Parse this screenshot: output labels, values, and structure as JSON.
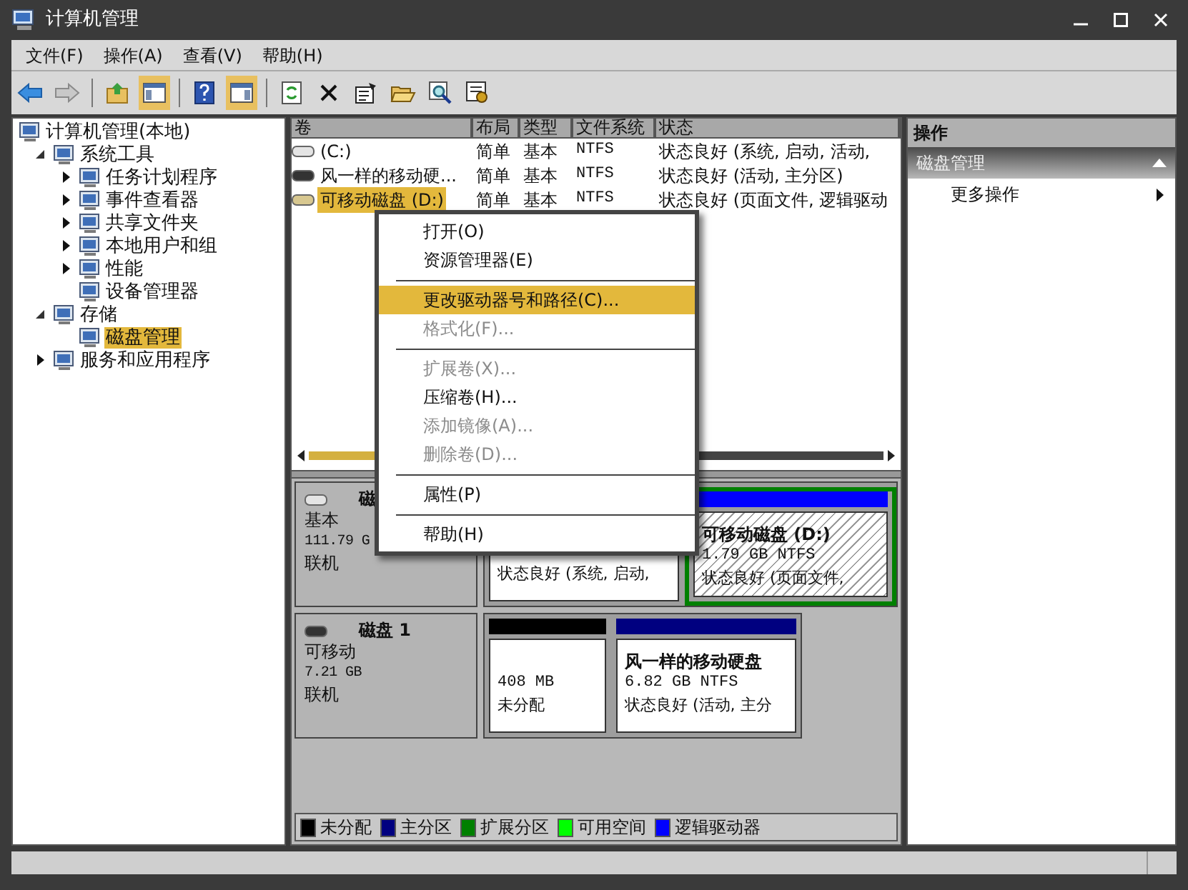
{
  "window": {
    "title": "计算机管理"
  },
  "menu_bar": [
    "文件(F)",
    "操作(A)",
    "查看(V)",
    "帮助(H)"
  ],
  "toolbar": [
    {
      "kind": "back",
      "on": false
    },
    {
      "kind": "forward",
      "on": false
    },
    {
      "kind": "separator"
    },
    {
      "kind": "up",
      "on": false
    },
    {
      "kind": "console-tree",
      "on": true
    },
    {
      "kind": "separator"
    },
    {
      "kind": "help",
      "on": false
    },
    {
      "kind": "action-pane",
      "on": true
    },
    {
      "kind": "separator"
    },
    {
      "kind": "refresh",
      "on": false
    },
    {
      "kind": "delete",
      "on": false
    },
    {
      "kind": "properties",
      "on": false
    },
    {
      "kind": "open",
      "on": false
    },
    {
      "kind": "search",
      "on": false
    },
    {
      "kind": "settings",
      "on": false
    }
  ],
  "tree": [
    {
      "label": "计算机管理(本地)",
      "selected": false,
      "children": [
        {
          "label": "系统工具",
          "expanded": true,
          "selected": false,
          "children": [
            {
              "label": "任务计划程序",
              "expanded": false,
              "selected": false
            },
            {
              "label": "事件查看器",
              "expanded": false,
              "selected": false
            },
            {
              "label": "共享文件夹",
              "expanded": false,
              "selected": false
            },
            {
              "label": "本地用户和组",
              "expanded": false,
              "selected": false
            },
            {
              "label": "性能",
              "expanded": false,
              "selected": false
            },
            {
              "label": "设备管理器",
              "selected": false
            }
          ]
        },
        {
          "label": "存储",
          "expanded": true,
          "selected": false,
          "children": [
            {
              "label": "磁盘管理",
              "selected": true
            }
          ]
        },
        {
          "label": "服务和应用程序",
          "expanded": false,
          "selected": false
        }
      ]
    }
  ],
  "volume_table": {
    "columns": [
      "卷",
      "布局",
      "类型",
      "文件系统",
      "状态"
    ],
    "rows": [
      {
        "cells": [
          "(C:)",
          "简单",
          "基本",
          "NTFS",
          "状态良好 (系统, 启动, 活动,"
        ],
        "selected": false
      },
      {
        "cells": [
          "风一样的移动硬...",
          "简单",
          "基本",
          "NTFS",
          "状态良好 (活动, 主分区)"
        ],
        "selected": false
      },
      {
        "cells": [
          "可移动磁盘 (D:)",
          "简单",
          "基本",
          "NTFS",
          "状态良好 (页面文件, 逻辑驱动"
        ],
        "selected": true
      }
    ]
  },
  "disks": [
    {
      "name": "磁",
      "type": "基本",
      "size": "111.79 G",
      "status": "联机",
      "partitions": [
        {
          "kind": "primary",
          "status": "状态良好 (系统, 启动,",
          "selected": false
        },
        {
          "kind": "logical",
          "name": "可移动磁盘 (D:)",
          "size": "1.79 GB NTFS",
          "status": "状态良好 (页面文件, ",
          "selected": true
        }
      ]
    },
    {
      "name": "磁盘 1",
      "type": "可移动",
      "size": "7.21 GB",
      "status": "联机",
      "partitions": [
        {
          "kind": "unallocated",
          "size": "408 MB",
          "status": "未分配",
          "selected": false
        },
        {
          "kind": "primary",
          "name": "风一样的移动硬盘",
          "size": "6.82 GB NTFS",
          "status": "状态良好 (活动, 主分",
          "selected": false
        }
      ]
    }
  ],
  "legend": [
    {
      "label": "未分配",
      "color": "#000000"
    },
    {
      "label": "主分区",
      "color": "#000080"
    },
    {
      "label": "扩展分区",
      "color": "#008000"
    },
    {
      "label": "可用空间",
      "color": "#00ff00"
    },
    {
      "label": "逻辑驱动器",
      "color": "#0000ff"
    }
  ],
  "actions": {
    "title": "操作",
    "section": "磁盘管理",
    "expanded": true,
    "items": [
      "更多操作"
    ]
  },
  "context_menu": [
    {
      "kind": "item",
      "label": "打开(O)",
      "disabled": false,
      "selected": false
    },
    {
      "kind": "item",
      "label": "资源管理器(E)",
      "disabled": false,
      "selected": false
    },
    {
      "kind": "separator"
    },
    {
      "kind": "item",
      "label": "更改驱动器号和路径(C)...",
      "disabled": false,
      "selected": true
    },
    {
      "kind": "item",
      "label": "格式化(F)...",
      "disabled": true,
      "selected": false
    },
    {
      "kind": "separator"
    },
    {
      "kind": "item",
      "label": "扩展卷(X)...",
      "disabled": true,
      "selected": false
    },
    {
      "kind": "item",
      "label": "压缩卷(H)...",
      "disabled": false,
      "selected": false
    },
    {
      "kind": "item",
      "label": "添加镜像(A)...",
      "disabled": true,
      "selected": false
    },
    {
      "kind": "item",
      "label": "删除卷(D)...",
      "disabled": true,
      "selected": false
    },
    {
      "kind": "separator"
    },
    {
      "kind": "item",
      "label": "属性(P)",
      "disabled": false,
      "selected": false
    },
    {
      "kind": "separator"
    },
    {
      "kind": "item",
      "label": "帮助(H)",
      "disabled": false,
      "selected": false
    }
  ]
}
